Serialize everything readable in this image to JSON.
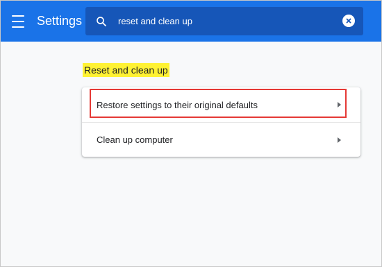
{
  "header": {
    "title": "Settings",
    "menu_icon": "hamburger-menu-icon",
    "search": {
      "value": "reset and clean up",
      "icon": "search-icon",
      "clear_icon": "clear-circle-icon"
    },
    "bg_color": "#1a73e8"
  },
  "main": {
    "section_title": "Reset and clean up",
    "highlight_color": "#fff233",
    "items": [
      {
        "label": "Restore settings to their original defaults",
        "icon": "chevron-right-icon",
        "outlined": true
      },
      {
        "label": "Clean up computer",
        "icon": "chevron-right-icon",
        "outlined": false
      }
    ],
    "outline_color": "#e53935"
  }
}
